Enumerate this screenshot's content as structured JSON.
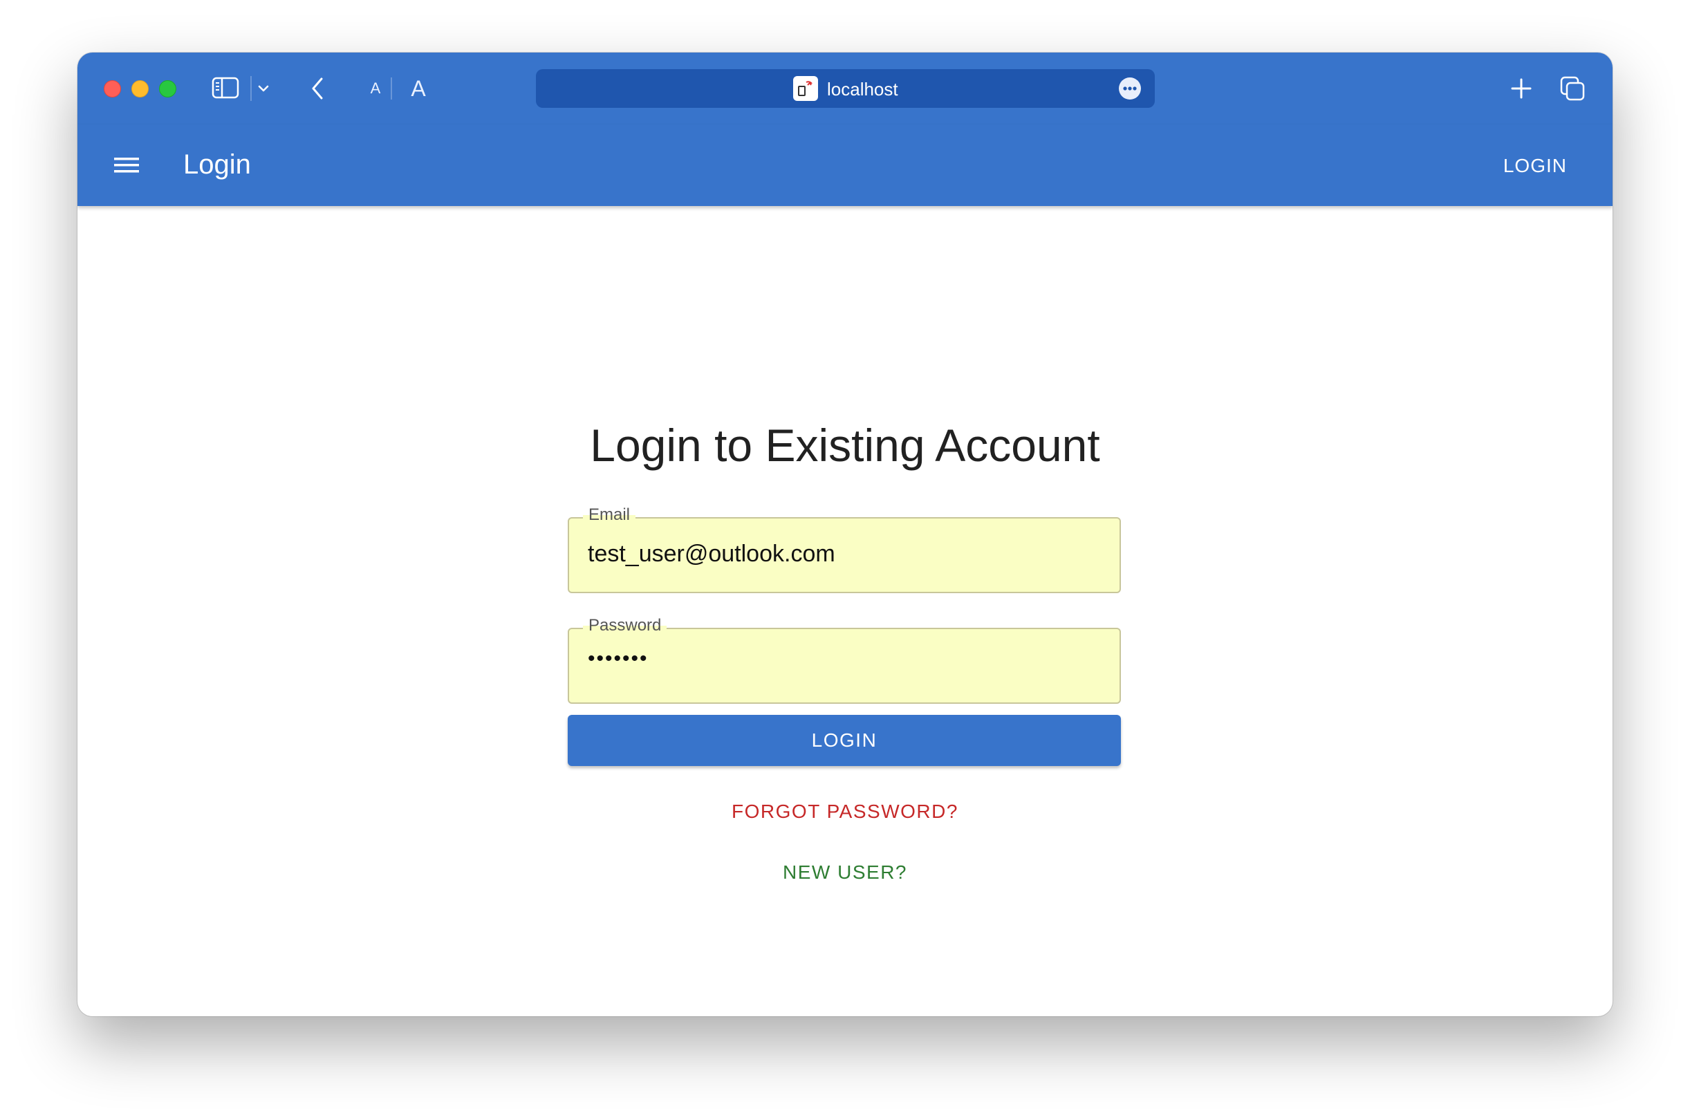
{
  "colors": {
    "brand": "#3874cb",
    "address_bar": "#1f56ae",
    "autofill": "#fafec4",
    "danger": "#c62828",
    "success": "#2e7d32",
    "heading": "#212121"
  },
  "browser": {
    "address": "localhost",
    "font_small_label": "A",
    "font_large_label": "A",
    "icons": [
      "sidebar-icon",
      "chevron-down-icon",
      "chevron-left-icon",
      "plus-icon",
      "tabs-overview-icon",
      "ellipsis-icon",
      "site-favicon-icon"
    ]
  },
  "appbar": {
    "title": "Login",
    "login_label": "LOGIN",
    "menu_icon": "hamburger-menu-icon"
  },
  "form": {
    "heading": "Login to Existing Account",
    "email": {
      "label": "Email",
      "value": "test_user@outlook.com"
    },
    "password": {
      "label": "Password",
      "masked_value": "•••••••"
    },
    "submit_label": "LOGIN",
    "forgot_label": "FORGOT PASSWORD?",
    "new_user_label": "NEW USER?"
  }
}
